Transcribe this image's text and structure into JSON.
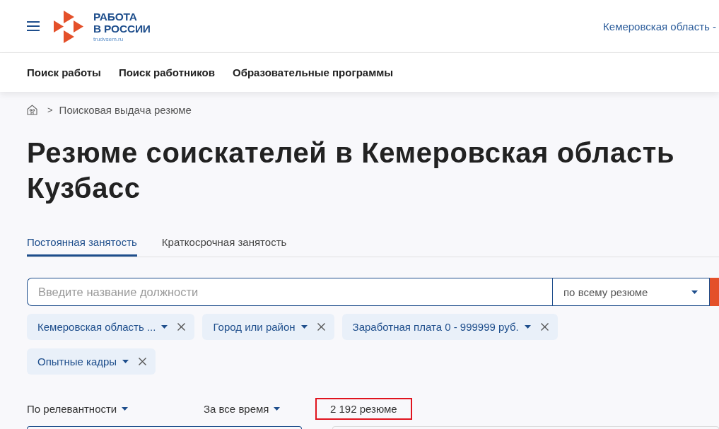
{
  "header": {
    "logo": {
      "line_1": "РАБОТА",
      "line_2": "В РОССИИ",
      "domain": "trudvsem.ru"
    },
    "region": "Кемеровская область -"
  },
  "nav": [
    "Поиск работы",
    "Поиск работников",
    "Образовательные программы"
  ],
  "breadcrumb": {
    "separator": ">",
    "current": "Поисковая выдача резюме"
  },
  "title": "Резюме соискателей в Кемеровская область Кузбасс",
  "tabs": [
    {
      "label": "Постоянная занятость",
      "selected": true
    },
    {
      "label": "Краткосрочная занятость",
      "selected": false
    }
  ],
  "search": {
    "placeholder": "Введите название должности",
    "scope": "по всему резюме"
  },
  "filters": [
    {
      "label": "Кемеровская область ..."
    },
    {
      "label": "Город или район"
    },
    {
      "label": "Заработная плата 0 - 999999 руб."
    },
    {
      "label": "Опытные кадры"
    }
  ],
  "sorting": [
    {
      "label": "По релевантности"
    },
    {
      "label": "За все время"
    }
  ],
  "result_count": {
    "text": "2 192 резюме",
    "highlighted": true
  }
}
